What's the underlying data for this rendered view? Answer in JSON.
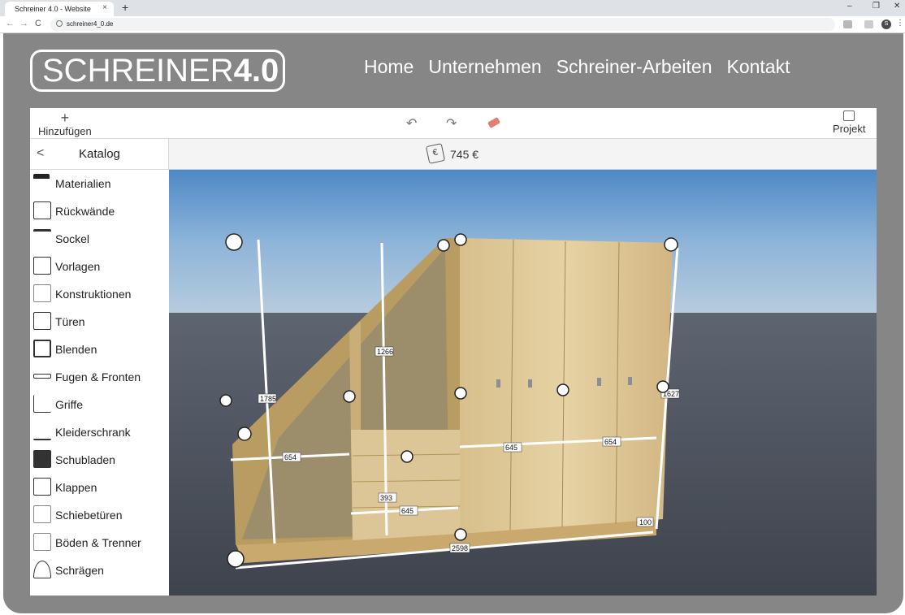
{
  "browser": {
    "tab_title": "Schreiner 4.0 - Website",
    "tab_close": "×",
    "new_tab": "+",
    "url": "schreiner4_0.de",
    "profile_initial": "S",
    "win_min": "–",
    "win_max": "❐",
    "win_close": "✕",
    "nav_back": "←",
    "nav_forward": "→",
    "nav_reload": "C",
    "menu": "⋮"
  },
  "site": {
    "logo_light": "SCHREINER",
    "logo_bold": "4.0",
    "nav": [
      "Home",
      "Unternehmen",
      "Schreiner-Arbeiten",
      "Kontakt"
    ]
  },
  "toolbar": {
    "add_label": "Hinzufügen",
    "add_icon": "+",
    "undo_icon": "↶",
    "redo_icon": "↷",
    "project_label": "Projekt"
  },
  "catalog": {
    "back_icon": "<",
    "title": "Katalog",
    "price": "745 €",
    "price_icon_text": "€",
    "items": [
      "Materialien",
      "Rückwände",
      "Sockel",
      "Vorlagen",
      "Konstruktionen",
      "Türen",
      "Blenden",
      "Fugen & Fronten",
      "Griffe",
      "Kleiderschrank",
      "Schubladen",
      "Klappen",
      "Schiebetüren",
      "Böden & Trenner",
      "Schrägen"
    ]
  },
  "viewport": {
    "dimensions": {
      "left_height": "1785",
      "mid_height": "1266",
      "right_height": "1627",
      "left_width": "654",
      "mid_width_top": "645",
      "right_width": "654",
      "drawer_height": "393",
      "drawer_width": "645",
      "depth": "100",
      "total_width": "2598"
    }
  }
}
